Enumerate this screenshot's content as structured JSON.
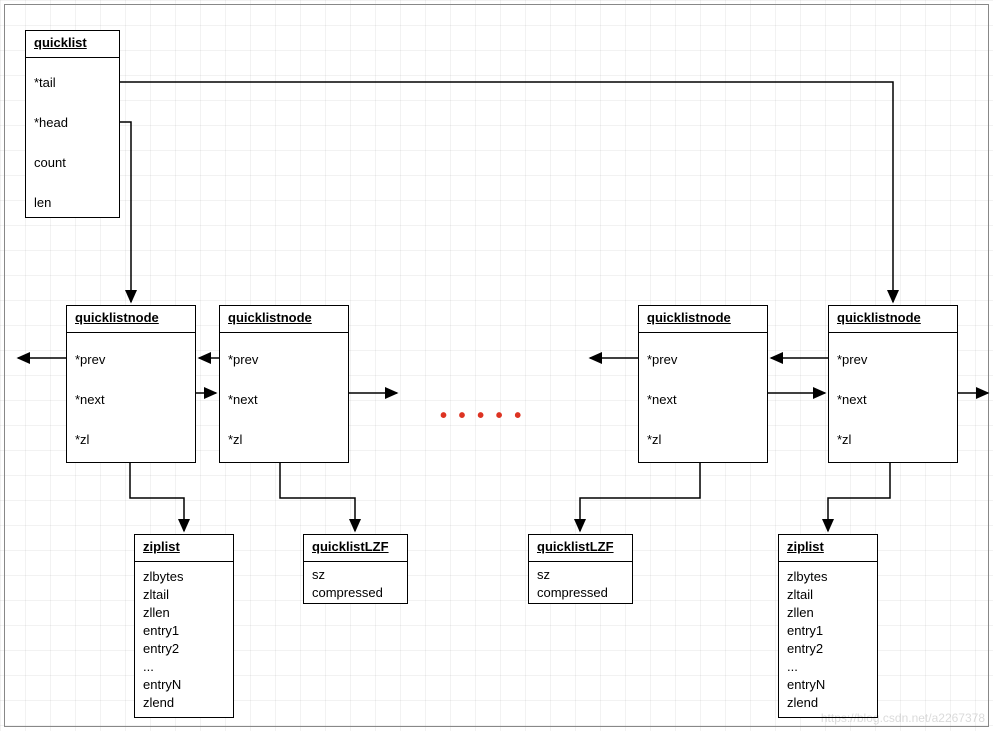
{
  "quicklist": {
    "title": "quicklist",
    "fields": [
      "*tail",
      "*head",
      "count",
      "len"
    ]
  },
  "quicklistnode": {
    "title": "quicklistnode",
    "fields": [
      "*prev",
      "*next",
      "*zl"
    ]
  },
  "ziplist": {
    "title": "ziplist",
    "fields": [
      "zlbytes",
      "zltail",
      "zllen",
      "entry1",
      "entry2",
      "...",
      "entryN",
      "zlend"
    ]
  },
  "quicklistLZF": {
    "title": "quicklistLZF",
    "f_sz": "sz",
    "f_compressed": "compressed"
  },
  "ellipsis": "• • • • •",
  "watermark": "https://blog.csdn.net/a2267378"
}
